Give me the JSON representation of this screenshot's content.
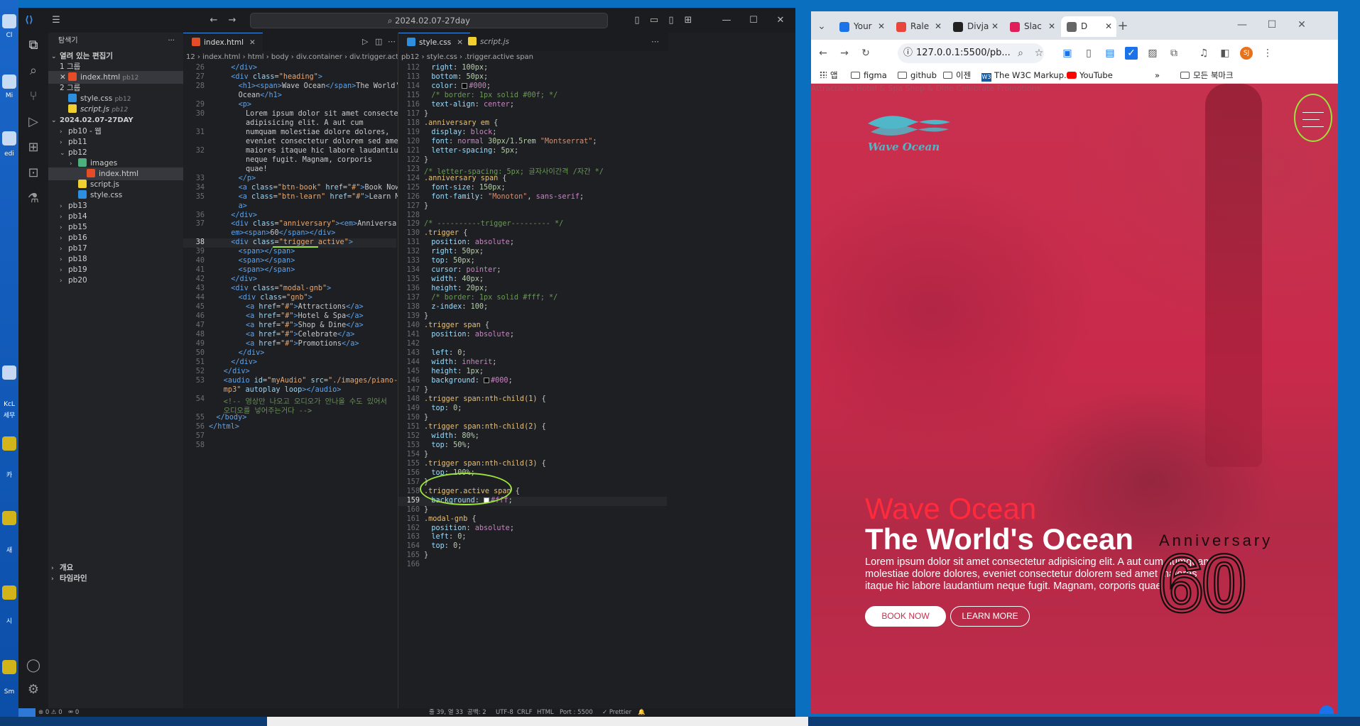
{
  "desktop": {
    "icons": [
      "Cl",
      "Mi",
      "edi",
      "KcL",
      "세무",
      "카",
      "Sm",
      "새",
      "시"
    ]
  },
  "vscode": {
    "title": "2024.02.07-27day",
    "explorer": {
      "header": "탐색기",
      "open_editors": "열려 있는 편집기",
      "group1": "1 그룹",
      "group2": "2 그룹",
      "open_files": [
        {
          "name": "index.html",
          "dir": "pb12",
          "type": "html"
        },
        {
          "name": "style.css",
          "dir": "pb12",
          "type": "css"
        },
        {
          "name": "script.js",
          "dir": "pb12",
          "type": "js"
        }
      ],
      "folder": "2024.02.07-27DAY",
      "tree": [
        {
          "name": "pb10 - 웹",
          "type": "folder",
          "open": false,
          "depth": 1
        },
        {
          "name": "pb11",
          "type": "folder",
          "open": false,
          "depth": 1
        },
        {
          "name": "pb12",
          "type": "folder",
          "open": true,
          "depth": 1
        },
        {
          "name": "images",
          "type": "img",
          "open": false,
          "depth": 2
        },
        {
          "name": "index.html",
          "type": "html",
          "depth": 2,
          "selected": true
        },
        {
          "name": "script.js",
          "type": "js",
          "depth": 2
        },
        {
          "name": "style.css",
          "type": "css",
          "depth": 2
        },
        {
          "name": "pb13",
          "type": "folder",
          "depth": 1
        },
        {
          "name": "pb14",
          "type": "folder",
          "depth": 1
        },
        {
          "name": "pb15",
          "type": "folder",
          "depth": 1
        },
        {
          "name": "pb16",
          "type": "folder",
          "depth": 1
        },
        {
          "name": "pb17",
          "type": "folder",
          "depth": 1
        },
        {
          "name": "pb18",
          "type": "folder",
          "depth": 1
        },
        {
          "name": "pb19",
          "type": "folder",
          "depth": 1
        },
        {
          "name": "pb20",
          "type": "folder",
          "depth": 1
        }
      ],
      "outline": "개요",
      "timeline": "타임라인"
    },
    "left_editor": {
      "tab": "index.html",
      "breadcrumb": "12 › index.html › html › body › div.container › div.trigger.active",
      "lines": [
        {
          "n": "26",
          "html": "<span class='t-tag'>&lt;/div&gt;</span>",
          "ind": 3
        },
        {
          "n": "27",
          "html": "<span class='t-tag'>&lt;div</span> <span class='t-attr'>class</span>=<span class='t-str'>\"heading\"</span><span class='t-tag'>&gt;</span>",
          "ind": 3
        },
        {
          "n": "28",
          "html": "<span class='t-tag'>&lt;h1&gt;&lt;span&gt;</span>Wave Ocean<span class='t-tag'>&lt;/span&gt;</span>The World's",
          "ind": 4
        },
        {
          "n": "",
          "html": "Ocean<span class='t-tag'>&lt;/h1&gt;</span>",
          "ind": 4
        },
        {
          "n": "29",
          "html": "<span class='t-tag'>&lt;p&gt;</span>",
          "ind": 4
        },
        {
          "n": "30",
          "html": "Lorem ipsum dolor sit amet consectetur",
          "ind": 5
        },
        {
          "n": "",
          "html": "adipisicing elit. A aut cum",
          "ind": 5
        },
        {
          "n": "31",
          "html": "numquam molestiae dolore dolores,",
          "ind": 5
        },
        {
          "n": "",
          "html": "eveniet consectetur dolorem sed amet",
          "ind": 5
        },
        {
          "n": "32",
          "html": "maiores itaque hic labore laudantium",
          "ind": 5
        },
        {
          "n": "",
          "html": "neque fugit. Magnam, corporis",
          "ind": 5
        },
        {
          "n": "",
          "html": "quae!",
          "ind": 5
        },
        {
          "n": "33",
          "html": "<span class='t-tag'>&lt;/p&gt;</span>",
          "ind": 4
        },
        {
          "n": "34",
          "html": "<span class='t-tag'>&lt;a</span> <span class='t-attr'>class</span>=<span class='t-str'>\"btn-book\"</span> <span class='t-attr'>href</span>=<span class='t-str'>\"#\"</span><span class='t-tag'>&gt;</span>Book Now<span class='t-tag'>&lt;/a&gt;</span>",
          "ind": 4
        },
        {
          "n": "35",
          "html": "<span class='t-tag'>&lt;a</span> <span class='t-attr'>class</span>=<span class='t-str'>\"btn-learn\"</span> <span class='t-attr'>href</span>=<span class='t-str'>\"#\"</span><span class='t-tag'>&gt;</span>Learn More<span class='t-tag'>&lt;/</span>",
          "ind": 4
        },
        {
          "n": "",
          "html": "<span class='t-tag'>a&gt;</span>",
          "ind": 4
        },
        {
          "n": "36",
          "html": "<span class='t-tag'>&lt;/div&gt;</span>",
          "ind": 3
        },
        {
          "n": "37",
          "html": "<span class='t-tag'>&lt;div</span> <span class='t-attr'>class</span>=<span class='t-str'>\"anniversary\"</span><span class='t-tag'>&gt;&lt;em&gt;</span>Anniversary<span class='t-tag'>&lt;/</span>",
          "ind": 3
        },
        {
          "n": "",
          "html": "<span class='t-tag'>em&gt;&lt;span&gt;</span>60<span class='t-tag'>&lt;/span&gt;&lt;/div&gt;</span>",
          "ind": 3
        },
        {
          "n": "38",
          "html": "<span class='t-tag'>&lt;div</span> <span class='t-attr'>class</span>=<span class='t-str'>\"trigger active\"</span><span class='t-tag'>&gt;</span>",
          "ind": 3,
          "cur": true
        },
        {
          "n": "39",
          "html": "<span class='t-tag'>&lt;span&gt;&lt;/span&gt;</span>",
          "ind": 4
        },
        {
          "n": "40",
          "html": "<span class='t-tag'>&lt;span&gt;&lt;/span&gt;</span>",
          "ind": 4
        },
        {
          "n": "41",
          "html": "<span class='t-tag'>&lt;span&gt;&lt;/span&gt;</span>",
          "ind": 4
        },
        {
          "n": "42",
          "html": "<span class='t-tag'>&lt;/div&gt;</span>",
          "ind": 3
        },
        {
          "n": "43",
          "html": "<span class='t-tag'>&lt;div</span> <span class='t-attr'>class</span>=<span class='t-str'>\"modal-gnb\"</span><span class='t-tag'>&gt;</span>",
          "ind": 3
        },
        {
          "n": "44",
          "html": "<span class='t-tag'>&lt;div</span> <span class='t-attr'>class</span>=<span class='t-str'>\"gnb\"</span><span class='t-tag'>&gt;</span>",
          "ind": 4
        },
        {
          "n": "45",
          "html": "<span class='t-tag'>&lt;a</span> <span class='t-attr'>href</span>=<span class='t-str'>\"#\"</span><span class='t-tag'>&gt;</span>Attractions<span class='t-tag'>&lt;/a&gt;</span>",
          "ind": 5
        },
        {
          "n": "46",
          "html": "<span class='t-tag'>&lt;a</span> <span class='t-attr'>href</span>=<span class='t-str'>\"#\"</span><span class='t-tag'>&gt;</span>Hotel &amp; Spa<span class='t-tag'>&lt;/a&gt;</span>",
          "ind": 5
        },
        {
          "n": "47",
          "html": "<span class='t-tag'>&lt;a</span> <span class='t-attr'>href</span>=<span class='t-str'>\"#\"</span><span class='t-tag'>&gt;</span>Shop &amp; Dine<span class='t-tag'>&lt;/a&gt;</span>",
          "ind": 5
        },
        {
          "n": "48",
          "html": "<span class='t-tag'>&lt;a</span> <span class='t-attr'>href</span>=<span class='t-str'>\"#\"</span><span class='t-tag'>&gt;</span>Celebrate<span class='t-tag'>&lt;/a&gt;</span>",
          "ind": 5
        },
        {
          "n": "49",
          "html": "<span class='t-tag'>&lt;a</span> <span class='t-attr'>href</span>=<span class='t-str'>\"#\"</span><span class='t-tag'>&gt;</span>Promotions<span class='t-tag'>&lt;/a&gt;</span>",
          "ind": 5
        },
        {
          "n": "50",
          "html": "<span class='t-tag'>&lt;/div&gt;</span>",
          "ind": 4
        },
        {
          "n": "51",
          "html": "<span class='t-tag'>&lt;/div&gt;</span>",
          "ind": 3
        },
        {
          "n": "52",
          "html": "<span class='t-tag'>&lt;/div&gt;</span>",
          "ind": 2
        },
        {
          "n": "53",
          "html": "<span class='t-tag'>&lt;audio</span> <span class='t-attr'>id</span>=<span class='t-str'>\"myAudio\"</span> <span class='t-attr'>src</span>=<span class='t-str'>\"./images/piano-bgm.</span>",
          "ind": 2
        },
        {
          "n": "",
          "html": "<span class='t-str'>mp3\"</span> <span class='t-attr'>autoplay loop</span><span class='t-tag'>&gt;&lt;/audio&gt;</span>",
          "ind": 2
        },
        {
          "n": "54",
          "html": "<span class='t-cm'>&lt;!-- 영상만 나오고 오디오가 안나올 수도 있어서</span>",
          "ind": 2
        },
        {
          "n": "",
          "html": "<span class='t-cm'>오디오를 넣어주는거다 --&gt;</span>",
          "ind": 2
        },
        {
          "n": "55",
          "html": "<span class='t-tag'>&lt;/body&gt;</span>",
          "ind": 1
        },
        {
          "n": "56",
          "html": "<span class='t-tag'>&lt;/html&gt;</span>",
          "ind": 0
        },
        {
          "n": "57",
          "html": "",
          "ind": 0
        },
        {
          "n": "58",
          "html": "",
          "ind": 0
        }
      ]
    },
    "right_editor": {
      "tab_css": "style.css",
      "tab_js": "script.js",
      "breadcrumb": "pb12 › style.css › .trigger.active span",
      "lines": [
        {
          "n": "112",
          "html": "<span class='c-prop'>right</span>: <span class='c-num'>100px</span>;",
          "ind": 1
        },
        {
          "n": "113",
          "html": "<span class='c-prop'>bottom</span>: <span class='c-num'>50px</span>;",
          "ind": 1
        },
        {
          "n": "114",
          "html": "<span class='c-prop'>color</span>: <span class='sw' style='background:#000'></span><span class='c-val'>#000</span>;",
          "ind": 1
        },
        {
          "n": "115",
          "html": "<span class='c-cm'>/* border: 1px solid #00f; */</span>",
          "ind": 1
        },
        {
          "n": "116",
          "html": "<span class='c-prop'>text-align</span>: <span class='c-val'>center</span>;",
          "ind": 1
        },
        {
          "n": "117",
          "html": "}",
          "ind": 0
        },
        {
          "n": "118",
          "html": "<span class='c-sel'>.anniversary em</span> {",
          "ind": 0
        },
        {
          "n": "119",
          "html": "<span class='c-prop'>display</span>: <span class='c-val'>block</span>;",
          "ind": 1
        },
        {
          "n": "120",
          "html": "<span class='c-prop'>font</span>: <span class='c-val'>normal</span> <span class='c-num'>30px/1.5rem</span> <span class='c-str'>\"Montserrat\"</span>;",
          "ind": 1
        },
        {
          "n": "121",
          "html": "<span class='c-prop'>letter-spacing</span>: <span class='c-num'>5px</span>;",
          "ind": 1
        },
        {
          "n": "122",
          "html": "}",
          "ind": 0
        },
        {
          "n": "123",
          "html": "<span class='c-cm'>/* letter-spacing: 5px; 글자사이간격 /자간 */</span>",
          "ind": 0
        },
        {
          "n": "124",
          "html": "<span class='c-sel'>.anniversary span</span> {",
          "ind": 0
        },
        {
          "n": "125",
          "html": "<span class='c-prop'>font-size</span>: <span class='c-num'>150px</span>;",
          "ind": 1
        },
        {
          "n": "126",
          "html": "<span class='c-prop'>font-family</span>: <span class='c-str'>\"Monoton\"</span>, <span class='c-val'>sans-serif</span>;",
          "ind": 1
        },
        {
          "n": "127",
          "html": "}",
          "ind": 0
        },
        {
          "n": "128",
          "html": "",
          "ind": 0
        },
        {
          "n": "129",
          "html": "<span class='c-cm'>/* ----------trigger--------- */</span>",
          "ind": 0
        },
        {
          "n": "130",
          "html": "<span class='c-sel'>.trigger</span> {",
          "ind": 0
        },
        {
          "n": "131",
          "html": "<span class='c-prop'>position</span>: <span class='c-val'>absolute</span>;",
          "ind": 1
        },
        {
          "n": "132",
          "html": "<span class='c-prop'>right</span>: <span class='c-num'>50px</span>;",
          "ind": 1
        },
        {
          "n": "133",
          "html": "<span class='c-prop'>top</span>: <span class='c-num'>50px</span>;",
          "ind": 1
        },
        {
          "n": "134",
          "html": "<span class='c-prop'>cursor</span>: <span class='c-val'>pointer</span>;",
          "ind": 1
        },
        {
          "n": "135",
          "html": "<span class='c-prop'>width</span>: <span class='c-num'>40px</span>;",
          "ind": 1
        },
        {
          "n": "136",
          "html": "<span class='c-prop'>height</span>: <span class='c-num'>20px</span>;",
          "ind": 1
        },
        {
          "n": "137",
          "html": "<span class='c-cm'>/* border: 1px solid #fff; */</span>",
          "ind": 1
        },
        {
          "n": "138",
          "html": "<span class='c-prop'>z-index</span>: <span class='c-num'>100</span>;",
          "ind": 1
        },
        {
          "n": "139",
          "html": "}",
          "ind": 0
        },
        {
          "n": "140",
          "html": "<span class='c-sel'>.trigger span</span> {",
          "ind": 0
        },
        {
          "n": "141",
          "html": "<span class='c-prop'>position</span>: <span class='c-val'>absolute</span>;",
          "ind": 1
        },
        {
          "n": "142",
          "html": "",
          "ind": 0
        },
        {
          "n": "143",
          "html": "<span class='c-prop'>left</span>: <span class='c-num'>0</span>;",
          "ind": 1
        },
        {
          "n": "144",
          "html": "<span class='c-prop'>width</span>: <span class='c-val'>inherit</span>;",
          "ind": 1
        },
        {
          "n": "145",
          "html": "<span class='c-prop'>height</span>: <span class='c-num'>1px</span>;",
          "ind": 1
        },
        {
          "n": "146",
          "html": "<span class='c-prop'>background</span>: <span class='sw' style='background:#000'></span><span class='c-val'>#000</span>;",
          "ind": 1
        },
        {
          "n": "147",
          "html": "}",
          "ind": 0
        },
        {
          "n": "148",
          "html": "<span class='c-sel'>.trigger span:nth-child(1)</span> {",
          "ind": 0
        },
        {
          "n": "149",
          "html": "<span class='c-prop'>top</span>: <span class='c-num'>0</span>;",
          "ind": 1
        },
        {
          "n": "150",
          "html": "}",
          "ind": 0
        },
        {
          "n": "151",
          "html": "<span class='c-sel'>.trigger span:nth-child(2)</span> {",
          "ind": 0
        },
        {
          "n": "152",
          "html": "<span class='c-prop'>width</span>: <span class='c-num'>80%</span>;",
          "ind": 1
        },
        {
          "n": "153",
          "html": "<span class='c-prop'>top</span>: <span class='c-num'>50%</span>;",
          "ind": 1
        },
        {
          "n": "154",
          "html": "}",
          "ind": 0
        },
        {
          "n": "155",
          "html": "<span class='c-sel'>.trigger span:nth-child(3)</span> {",
          "ind": 0
        },
        {
          "n": "156",
          "html": "<span class='c-prop'>top</span>: <span class='c-num'>100%</span>;",
          "ind": 1
        },
        {
          "n": "157",
          "html": "}",
          "ind": 0
        },
        {
          "n": "158",
          "html": "<span class='c-sel'>.trigger.active span</span> {",
          "ind": 0
        },
        {
          "n": "159",
          "html": "<span class='c-prop'>background</span>: <span class='sw' style='background:#fff'></span><span class='c-val'>#fff</span>;",
          "ind": 1,
          "cur": true
        },
        {
          "n": "160",
          "html": "}",
          "ind": 0
        },
        {
          "n": "161",
          "html": "<span class='c-sel'>.modal-gnb</span> {",
          "ind": 0
        },
        {
          "n": "162",
          "html": "<span class='c-prop'>position</span>: <span class='c-val'>absolute</span>;",
          "ind": 1
        },
        {
          "n": "163",
          "html": "<span class='c-prop'>left</span>: <span class='c-num'>0</span>;",
          "ind": 1
        },
        {
          "n": "164",
          "html": "<span class='c-prop'>top</span>: <span class='c-num'>0</span>;",
          "ind": 1
        },
        {
          "n": "165",
          "html": "}",
          "ind": 0
        },
        {
          "n": "166",
          "html": "",
          "ind": 0
        }
      ]
    },
    "status": {
      "problems": "⊗ 0 ⚠ 0",
      "ports": "⚮ 0",
      "position": "줄 39, 열 33",
      "spaces": "공백: 2",
      "encoding": "UTF-8",
      "eol": "CRLF",
      "language": "HTML",
      "port": "Port : 5500",
      "prettier": "✓ Prettier"
    }
  },
  "chrome": {
    "tabs": [
      {
        "label": "Your",
        "color": "#1a73e8"
      },
      {
        "label": "Rale",
        "color": "#e8453c"
      },
      {
        "label": "Divja",
        "color": "#222"
      },
      {
        "label": "Slac",
        "color": "#e01e5a"
      },
      {
        "label": "D",
        "color": "#666",
        "active": true
      }
    ],
    "url": "127.0.0.1:5500/pb...",
    "bookmarks": [
      "앱",
      "figma",
      "github",
      "이젠",
      "The W3C Markup...",
      "YouTube"
    ],
    "bookmarks_more": "»",
    "all_bookmarks": "모든 북마크",
    "profile": "SJ",
    "site": {
      "nav": "Attractions Hotel & Spa Shop & Dine Celebrate Promotions",
      "logo_text": "Wave Ocean",
      "h1_sub": "Wave Ocean",
      "h1_main": "The World's Ocean",
      "paragraph": "Lorem ipsum dolor sit amet consectetur adipisicing elit. A aut cum numquam molestiae dolore dolores, eveniet consectetur dolorem sed amet maiores itaque hic labore laudantium neque fugit. Magnam, corporis quae!",
      "btn_book": "BOOK NOW",
      "btn_learn": "LEARN MORE",
      "anniversary": "Anniversary",
      "anniversary_number": "60"
    }
  }
}
